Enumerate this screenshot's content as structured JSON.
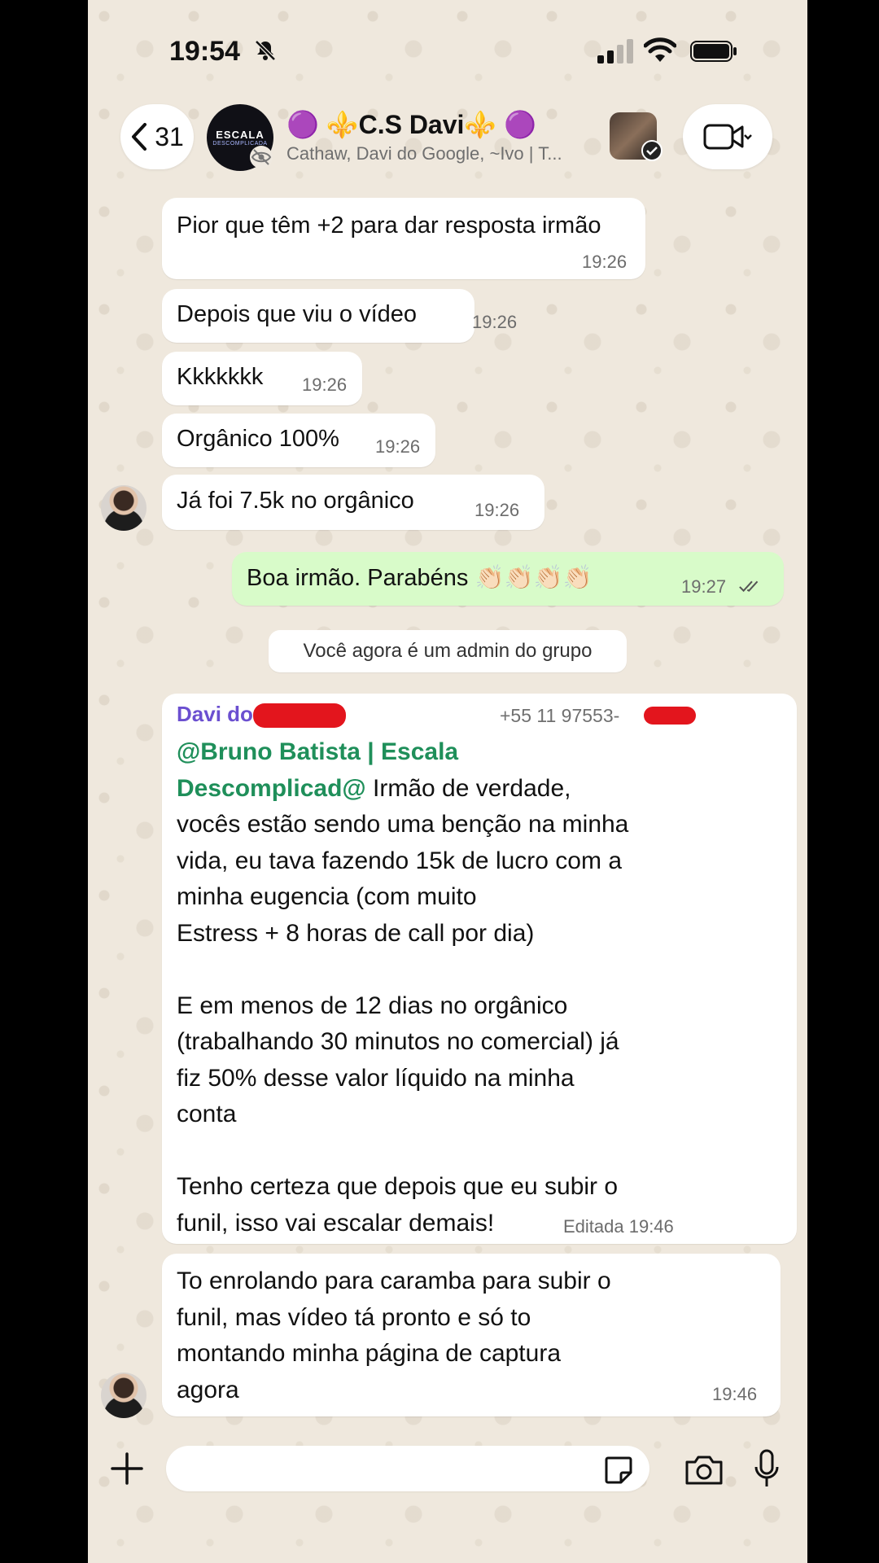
{
  "status_bar": {
    "time": "19:54"
  },
  "header": {
    "back_count": "31",
    "avatar_text_top": "ESCALA",
    "avatar_text_bottom": "DESCOMPLICADA",
    "title": "🟣 ⚜️C.S Davi⚜️ 🟣",
    "subtitle": "Cathaw, Davi do Google, ~Ivo | T..."
  },
  "messages": [
    {
      "text": "Pior que têm +2 para dar resposta irmão",
      "time": "19:26"
    },
    {
      "text": "Depois que viu o vídeo",
      "time": "19:26"
    },
    {
      "text": "Kkkkkkk",
      "time": "19:26"
    },
    {
      "text": "Orgânico 100%",
      "time": "19:26"
    },
    {
      "text": "Já foi 7.5k no orgânico",
      "time": "19:26"
    }
  ],
  "outgoing": {
    "text": "Boa irmão. Parabéns 👏🏻👏🏻👏🏻👏🏻",
    "time": "19:27"
  },
  "system_message": "Você agora é um admin do grupo",
  "long_message": {
    "sender": "Davi do",
    "phone": "+55 11 97553-",
    "mention_line1": "@Bruno Batista | Escala",
    "mention_line2": "Descomplicad@",
    "line2_rest": " Irmão de verdade,",
    "line3": "vocês estão sendo uma benção na minha",
    "line4": "vida, eu tava fazendo 15k de lucro com a",
    "line5": "minha eugencia (com muito",
    "line6": "Estress + 8 horas de call por dia)",
    "line8": "E em menos de 12 dias no orgânico",
    "line9": "(trabalhando 30 minutos no comercial)  já",
    "line10": "fiz 50% desse valor líquido na minha",
    "line11": "conta",
    "line13": "Tenho certeza que depois que eu subir o",
    "line14": "funil, isso vai escalar demais!",
    "edited_time": "Editada 19:46"
  },
  "last_message": {
    "line1": "To enrolando para caramba para subir o",
    "line2": "funil, mas vídeo tá pronto e só to",
    "line3": "montando minha página de captura",
    "line4": "agora",
    "time": "19:46"
  },
  "input": {
    "placeholder": ""
  },
  "colors": {
    "outgoing_bubble": "#d8fbc9",
    "sender_name": "#6b4fd0",
    "mention": "#1f8f5a",
    "redaction": "#e3151d"
  }
}
